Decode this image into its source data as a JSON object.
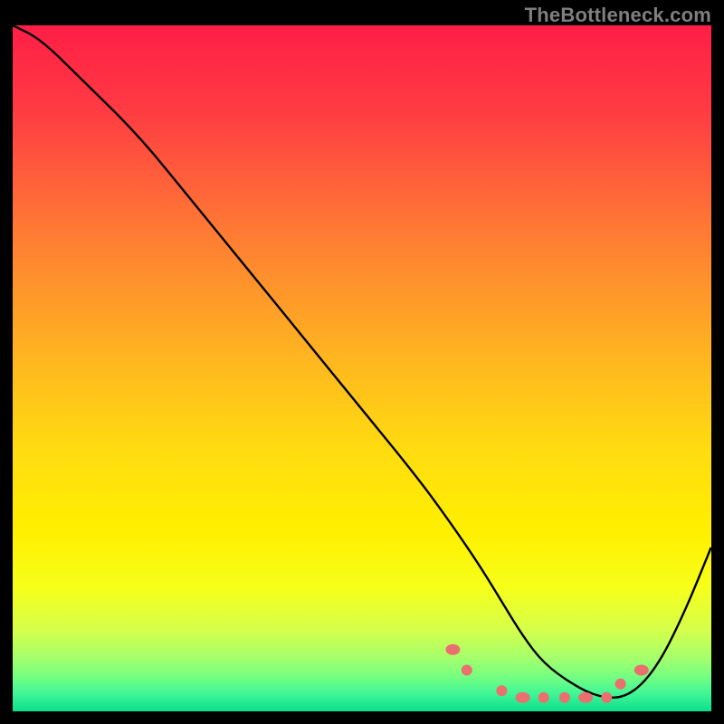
{
  "watermark": "TheBottleneck.com",
  "chart_data": {
    "type": "line",
    "title": "",
    "xlabel": "",
    "ylabel": "",
    "xlim": [
      0,
      100
    ],
    "ylim": [
      0,
      100
    ],
    "background": {
      "kind": "vertical-gradient",
      "stops": [
        {
          "t": 0.0,
          "color": "#ff1e46"
        },
        {
          "t": 0.12,
          "color": "#ff3a43"
        },
        {
          "t": 0.3,
          "color": "#ff7a34"
        },
        {
          "t": 0.48,
          "color": "#ffb420"
        },
        {
          "t": 0.62,
          "color": "#ffdc10"
        },
        {
          "t": 0.74,
          "color": "#fff000"
        },
        {
          "t": 0.82,
          "color": "#f6ff1a"
        },
        {
          "t": 0.88,
          "color": "#d6ff4a"
        },
        {
          "t": 0.92,
          "color": "#a8ff6a"
        },
        {
          "t": 0.95,
          "color": "#74ff82"
        },
        {
          "t": 0.975,
          "color": "#3ef596"
        },
        {
          "t": 1.0,
          "color": "#0bdf89"
        }
      ]
    },
    "series": [
      {
        "name": "curve",
        "color": "#000000",
        "x": [
          0,
          4,
          10,
          18,
          26,
          34,
          42,
          50,
          58,
          63,
          67,
          70,
          73,
          76,
          80,
          84,
          88,
          92,
          96,
          100
        ],
        "y": [
          100,
          98,
          92,
          84,
          74,
          64,
          54,
          44,
          34,
          27,
          21,
          16,
          11,
          7,
          4,
          2,
          2,
          6,
          14,
          24
        ]
      }
    ],
    "markers": {
      "name": "dotted-region",
      "color": "#eb6f6f",
      "points": [
        {
          "x": 63,
          "y": 9
        },
        {
          "x": 65,
          "y": 6
        },
        {
          "x": 70,
          "y": 3
        },
        {
          "x": 73,
          "y": 2
        },
        {
          "x": 76,
          "y": 2
        },
        {
          "x": 79,
          "y": 2
        },
        {
          "x": 82,
          "y": 2
        },
        {
          "x": 85,
          "y": 2
        },
        {
          "x": 87,
          "y": 4
        },
        {
          "x": 90,
          "y": 6
        }
      ]
    }
  }
}
